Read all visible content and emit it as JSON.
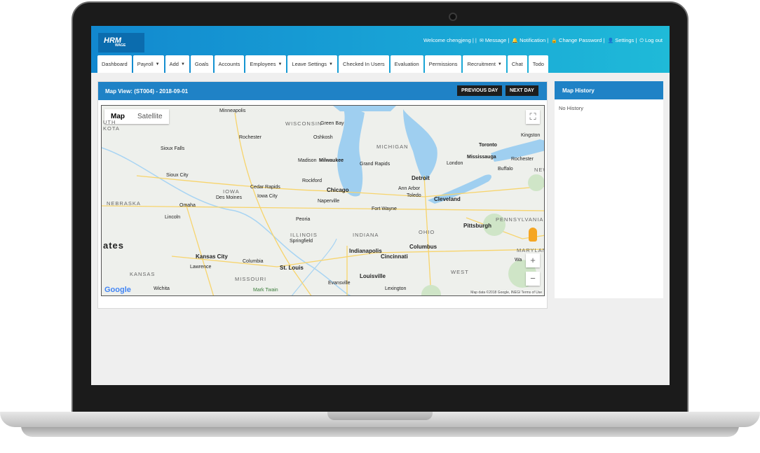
{
  "header": {
    "logo_text": "HRM",
    "logo_sub": "WAGE",
    "welcome": "Welcome chengjeng | |",
    "message": "Message |",
    "notification": "Notification |",
    "change_password": "Change Password |",
    "settings": "Settings |",
    "logout": "Log out"
  },
  "tabs": [
    {
      "label": "Dashboard",
      "caret": false
    },
    {
      "label": "Payroll",
      "caret": true
    },
    {
      "label": "Add",
      "caret": true
    },
    {
      "label": "Goals",
      "caret": false
    },
    {
      "label": "Accounts",
      "caret": false
    },
    {
      "label": "Employees",
      "caret": true
    },
    {
      "label": "Leave Settings",
      "caret": true
    },
    {
      "label": "Checked In Users",
      "caret": false
    },
    {
      "label": "Evaluation",
      "caret": false
    },
    {
      "label": "Permissions",
      "caret": false
    },
    {
      "label": "Recruitment",
      "caret": true
    },
    {
      "label": "Chat",
      "caret": false
    },
    {
      "label": "Todo",
      "caret": false
    }
  ],
  "main": {
    "title": "Map View: (ST004) - 2018-09-01",
    "prev_label": "PREVIOUS DAY",
    "next_label": "NEXT DAY"
  },
  "map": {
    "tab_map": "Map",
    "tab_satellite": "Satellite",
    "google": "Google",
    "attribution": "Map data ©2018 Google, INEGI  Terms of Use",
    "big_label": "ates",
    "cities": [
      "Minneapolis",
      "Rochester",
      "Green Bay",
      "Oshkosh",
      "Sioux Falls",
      "Madison",
      "Milwaukee",
      "Grand Rapids",
      "Toronto",
      "Mississauga",
      "Kingston",
      "London",
      "Buffalo",
      "Rochester",
      "Sioux City",
      "Rockford",
      "Chicago",
      "Detroit",
      "Ann Arbor",
      "Toledo",
      "Cleveland",
      "Cedar Rapids",
      "Iowa City",
      "Des Moines",
      "Naperville",
      "Fort Wayne",
      "Omaha",
      "Lincoln",
      "Peoria",
      "Pittsburgh",
      "Springfield",
      "Indianapolis",
      "Columbus",
      "Kansas City",
      "Columbia",
      "Lawrence",
      "St. Louis",
      "Cincinnati",
      "Louisville",
      "Evansville",
      "Lexington",
      "Wichita",
      "Mark Twain"
    ],
    "states": [
      "WISCONSIN",
      "MICHIGAN",
      "IOWA",
      "NEBRASKA",
      "ILLINOIS",
      "INDIANA",
      "OHIO",
      "PENNSYLVANIA",
      "MARYLAN",
      "KANSAS",
      "MISSOURI",
      "WEST",
      "KOTA",
      "UTH",
      "NEW"
    ],
    "wa": "Wa"
  },
  "side": {
    "title": "Map History",
    "empty": "No History"
  }
}
